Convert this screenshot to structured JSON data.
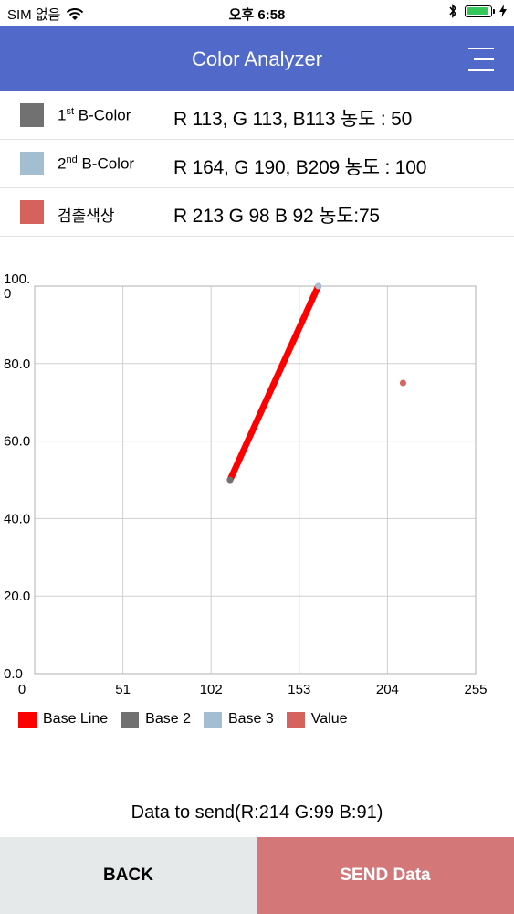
{
  "status": {
    "carrier": "SIM 없음",
    "time": "오후 6:58"
  },
  "header": {
    "title": "Color Analyzer"
  },
  "colors": [
    {
      "label_prefix": "1",
      "sup": "st",
      "label_suffix": " B-Color",
      "value": "R 113, G 113, B113  농도 : 50",
      "color": "#717171"
    },
    {
      "label_prefix": "2",
      "sup": "nd",
      "label_suffix": " B-Color",
      "value": "R 164, G 190, B209  농도 : 100",
      "color": "#a4bed1"
    },
    {
      "label_prefix": "검출색상",
      "sup": "",
      "label_suffix": "",
      "value": "R 213 G 98 B 92 농도:75",
      "color": "#d5625c"
    }
  ],
  "chart_data": {
    "type": "scatter",
    "xlim": [
      0,
      255
    ],
    "ylim": [
      0,
      100
    ],
    "x_ticks": [
      "0",
      "51",
      "102",
      "153",
      "204",
      "255"
    ],
    "y_ticks": [
      "0.0",
      "20.0",
      "40.0",
      "60.0",
      "80.0",
      "100.0"
    ],
    "grid": true,
    "legend_position": "bottom-left",
    "series": [
      {
        "name": "Base Line",
        "type": "line",
        "color": "#ff0000",
        "points": [
          [
            113,
            50
          ],
          [
            164,
            100
          ]
        ]
      },
      {
        "name": "Base 2",
        "type": "point",
        "color": "#717171",
        "points": [
          [
            113,
            50
          ]
        ]
      },
      {
        "name": "Base 3",
        "type": "point",
        "color": "#a4bed1",
        "points": [
          [
            164,
            100
          ]
        ]
      },
      {
        "name": "Value",
        "type": "point",
        "color": "#d5625c",
        "points": [
          [
            213,
            75
          ]
        ]
      }
    ]
  },
  "send_info": "Data to send(R:214 G:99 B:91)",
  "buttons": {
    "back": "BACK",
    "send": "SEND Data"
  }
}
